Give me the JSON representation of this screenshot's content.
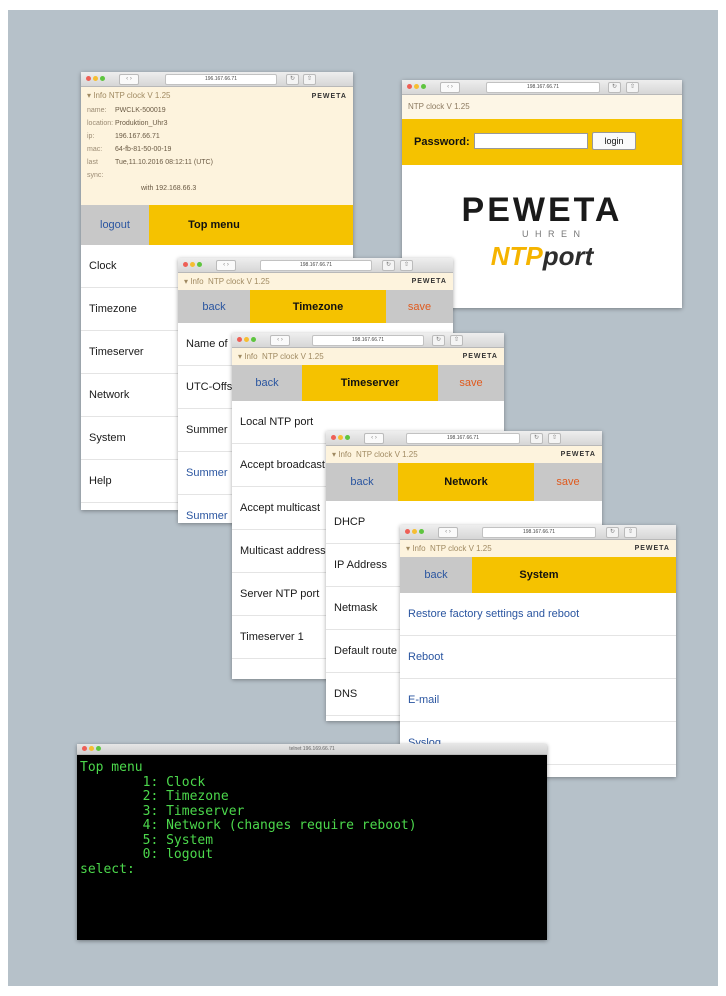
{
  "browser": {
    "url": "196.167.66.71",
    "url_alt": "198.167.66.71"
  },
  "app": {
    "info_label": "Info",
    "title": "NTP clock  V 1.25",
    "logo": "PEWETA"
  },
  "top_menu_window": {
    "info_header": "Info   NTP clock  V 1.25",
    "info_rows": [
      {
        "key": "name:",
        "value": "PWCLK-500019"
      },
      {
        "key": "location:",
        "value": "Produktion_Uhr3"
      },
      {
        "key": "ip:",
        "value": "196.167.66.71"
      },
      {
        "key": "mac:",
        "value": "64-fb-81-50-00-19"
      },
      {
        "key": "last sync:",
        "value": "Tue,11.10.2016 08:12:11 (UTC)"
      },
      {
        "key": "",
        "value": "with 192.168.66.3"
      }
    ],
    "logout_label": "logout",
    "menu_title": "Top menu",
    "items": [
      "Clock",
      "Timezone",
      "Timeserver",
      "Network",
      "System",
      "Help"
    ]
  },
  "login_window": {
    "header": "NTP clock  V 1.25",
    "password_label": "Password:",
    "login_label": "login",
    "brand": "PEWETA",
    "brand_sub": "U H R E N",
    "product_ntp": "NTP",
    "product_port": "port"
  },
  "timezone_window": {
    "back": "back",
    "title": "Timezone",
    "save": "save",
    "items": [
      "Name of",
      "UTC-Offs",
      "Summer",
      "Summer",
      "Summer"
    ]
  },
  "timeserver_window": {
    "back": "back",
    "title": "Timeserver",
    "save": "save",
    "items": [
      "Local NTP port",
      "Accept broadcast",
      "Accept multicast",
      "Multicast address",
      "Server NTP port",
      "Timeserver 1"
    ]
  },
  "network_window": {
    "back": "back",
    "title": "Network",
    "save": "save",
    "items": [
      "DHCP",
      "IP Address",
      "Netmask",
      "Default route",
      "DNS"
    ]
  },
  "system_window": {
    "back": "back",
    "title": "System",
    "items": [
      "Restore factory settings and reboot",
      "Reboot",
      "E-mail",
      "Syslog"
    ]
  },
  "terminal": {
    "title": "telnet 196.169.66.71",
    "lines": [
      "Top menu",
      "        1: Clock",
      "        2: Timezone",
      "        3: Timeserver",
      "        4: Network (changes require reboot)",
      "        5: System",
      "        0: logout",
      "select:"
    ]
  },
  "colors": {
    "accent": "#f5c200",
    "link": "#2a55a0",
    "save": "#e05a1e",
    "terminal_text": "#4cd84c",
    "background": "#b6c1c9"
  }
}
